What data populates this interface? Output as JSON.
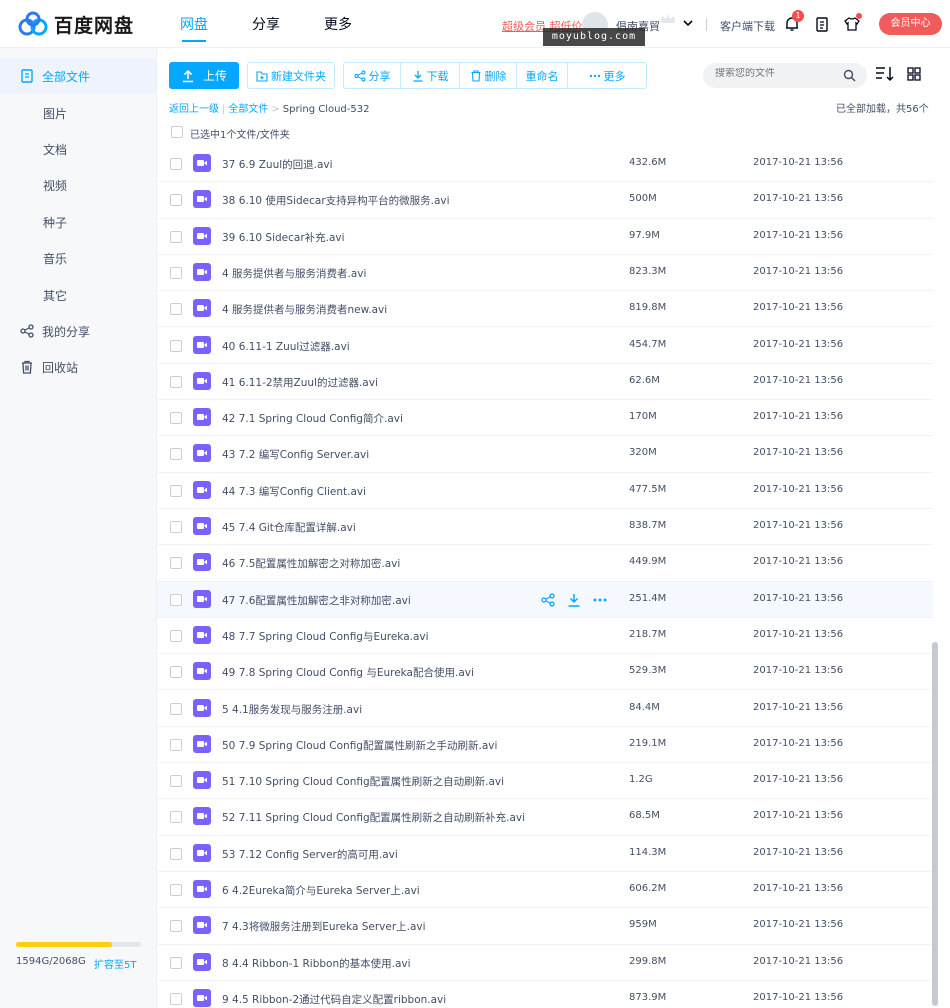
{
  "header": {
    "logo_text": "百度网盘",
    "nav": [
      "网盘",
      "分享",
      "更多"
    ],
    "vip_promo": "超级会员 超低价",
    "username": "倡南嘉貿",
    "client_download": "客户端下载",
    "notification_count": "1",
    "vip_center": "会员中心",
    "watermark": "moyublog.com"
  },
  "sidebar": {
    "items": [
      {
        "label": "全部文件",
        "icon": "file-icon"
      },
      {
        "label": "图片"
      },
      {
        "label": "文档"
      },
      {
        "label": "视频"
      },
      {
        "label": "种子"
      },
      {
        "label": "音乐"
      },
      {
        "label": "其它"
      },
      {
        "label": "我的分享",
        "icon": "share-icon"
      },
      {
        "label": "回收站",
        "icon": "trash-icon"
      }
    ],
    "storage_text": "1594G/2068G",
    "storage_fraction": 0.77,
    "storage_upgrade": "扩容至5T",
    "accent": "#f9cf0e"
  },
  "toolbar": {
    "upload": "上传",
    "new_folder": "新建文件夹",
    "share": "分享",
    "download": "下载",
    "delete": "删除",
    "rename": "重命名",
    "more": "更多",
    "search_placeholder": "搜索您的文件"
  },
  "breadcrumb": {
    "back": "返回上一级",
    "all_files": "全部文件",
    "current": "Spring Cloud-532"
  },
  "loaded_text": "已全部加载，共56个",
  "selection_text": "已选中1个文件/文件夹",
  "files": [
    {
      "name": "37 6.9 Zuul的回退.avi",
      "size": "432.6M",
      "date": "2017-10-21 13:56"
    },
    {
      "name": "38 6.10 使用Sidecar支持异构平台的微服务.avi",
      "size": "500M",
      "date": "2017-10-21 13:56"
    },
    {
      "name": "39 6.10 Sidecar补充.avi",
      "size": "97.9M",
      "date": "2017-10-21 13:56"
    },
    {
      "name": "4 服务提供者与服务消费者.avi",
      "size": "823.3M",
      "date": "2017-10-21 13:56"
    },
    {
      "name": "4 服务提供者与服务消费者new.avi",
      "size": "819.8M",
      "date": "2017-10-21 13:56"
    },
    {
      "name": "40 6.11-1 Zuul过滤器.avi",
      "size": "454.7M",
      "date": "2017-10-21 13:56"
    },
    {
      "name": "41 6.11-2禁用Zuul的过滤器.avi",
      "size": "62.6M",
      "date": "2017-10-21 13:56"
    },
    {
      "name": "42 7.1 Spring Cloud Config简介.avi",
      "size": "170M",
      "date": "2017-10-21 13:56"
    },
    {
      "name": "43 7.2 编写Config Server.avi",
      "size": "320M",
      "date": "2017-10-21 13:56"
    },
    {
      "name": "44 7.3 编写Config Client.avi",
      "size": "477.5M",
      "date": "2017-10-21 13:56"
    },
    {
      "name": "45 7.4 Git仓库配置详解.avi",
      "size": "838.7M",
      "date": "2017-10-21 13:56"
    },
    {
      "name": "46 7.5配置属性加解密之对称加密.avi",
      "size": "449.9M",
      "date": "2017-10-21 13:56"
    },
    {
      "name": "47 7.6配置属性加解密之非对称加密.avi",
      "size": "251.4M",
      "date": "2017-10-21 13:56"
    },
    {
      "name": "48 7.7 Spring Cloud Config与Eureka.avi",
      "size": "218.7M",
      "date": "2017-10-21 13:56"
    },
    {
      "name": "49 7.8 Spring Cloud Config 与Eureka配合使用.avi",
      "size": "529.3M",
      "date": "2017-10-21 13:56"
    },
    {
      "name": "5 4.1服务发现与服务注册.avi",
      "size": "84.4M",
      "date": "2017-10-21 13:56"
    },
    {
      "name": "50 7.9 Spring Cloud Config配置属性刷新之手动刷新.avi",
      "size": "219.1M",
      "date": "2017-10-21 13:56"
    },
    {
      "name": "51 7.10 Spring Cloud Config配置属性刷新之自动刷新.avi",
      "size": "1.2G",
      "date": "2017-10-21 13:56"
    },
    {
      "name": "52 7.11 Spring Cloud Config配置属性刷新之自动刷新补充.avi",
      "size": "68.5M",
      "date": "2017-10-21 13:56"
    },
    {
      "name": "53 7.12 Config Server的高可用.avi",
      "size": "114.3M",
      "date": "2017-10-21 13:56"
    },
    {
      "name": "6 4.2Eureka简介与Eureka Server上.avi",
      "size": "606.2M",
      "date": "2017-10-21 13:56"
    },
    {
      "name": "7 4.3将微服务注册到Eureka Server上.avi",
      "size": "959M",
      "date": "2017-10-21 13:56"
    },
    {
      "name": "8 4.4 Ribbon-1 Ribbon的基本使用.avi",
      "size": "299.8M",
      "date": "2017-10-21 13:56"
    },
    {
      "name": "9 4.5 Ribbon-2通过代码自定义配置ribbon.avi",
      "size": "873.9M",
      "date": "2017-10-21 13:56"
    }
  ],
  "hover_row_index": 12,
  "colors": {
    "accent": "#06a7ff",
    "video_icon": "#7b61ff",
    "vip": "#f25b5b"
  }
}
